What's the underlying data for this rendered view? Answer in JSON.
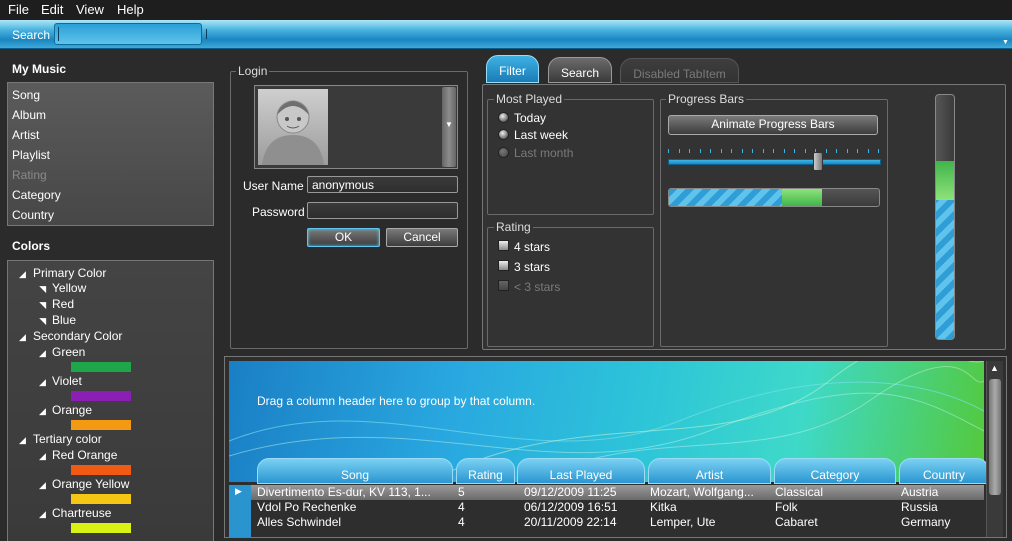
{
  "menu": {
    "items": [
      "File",
      "Edit",
      "View",
      "Help"
    ]
  },
  "searchbar": {
    "label": "Search",
    "value": ""
  },
  "my_music": {
    "title": "My Music",
    "items": [
      {
        "label": "Song",
        "disabled": false
      },
      {
        "label": "Album",
        "disabled": false
      },
      {
        "label": "Artist",
        "disabled": false
      },
      {
        "label": "Playlist",
        "disabled": false
      },
      {
        "label": "Rating",
        "disabled": true
      },
      {
        "label": "Category",
        "disabled": false
      },
      {
        "label": "Country",
        "disabled": false
      }
    ]
  },
  "colors": {
    "title": "Colors",
    "primary": {
      "label": "Primary Color",
      "children": [
        "Yellow",
        "Red",
        "Blue"
      ]
    },
    "secondary": {
      "label": "Secondary Color",
      "children": [
        {
          "label": "Green",
          "color": "#1fa64a"
        },
        {
          "label": "Violet",
          "color": "#8b1fb5"
        },
        {
          "label": "Orange",
          "color": "#f39a12"
        }
      ]
    },
    "tertiary": {
      "label": "Tertiary color",
      "children": [
        {
          "label": "Red Orange",
          "color": "#f05a12"
        },
        {
          "label": "Orange Yellow",
          "color": "#f5c613"
        },
        {
          "label": "Chartreuse",
          "color": "#d9f213"
        }
      ]
    }
  },
  "login": {
    "title": "Login",
    "username_label": "User Name",
    "username_value": "anonymous",
    "password_label": "Password",
    "password_value": "",
    "ok_label": "OK",
    "cancel_label": "Cancel"
  },
  "tabs": [
    {
      "label": "Filter",
      "state": "selected"
    },
    {
      "label": "Search",
      "state": "normal"
    },
    {
      "label": "Disabled TabItem",
      "state": "disabled"
    }
  ],
  "most_played": {
    "title": "Most Played",
    "options": [
      {
        "label": "Today",
        "disabled": false
      },
      {
        "label": "Last week",
        "disabled": false
      },
      {
        "label": "Last month",
        "disabled": true
      }
    ]
  },
  "rating": {
    "title": "Rating",
    "options": [
      {
        "label": "4 stars",
        "disabled": false
      },
      {
        "label": "3 stars",
        "disabled": false
      },
      {
        "label": "< 3 stars",
        "disabled": true
      }
    ]
  },
  "progress": {
    "title": "Progress Bars",
    "button_label": "Animate Progress Bars",
    "slider_value": 0.72,
    "horizontal_value": 0.73,
    "vertical_value": 0.73
  },
  "grid": {
    "group_hint": "Drag a column header here to group by that column.",
    "columns": [
      "Song",
      "Rating",
      "Last Played",
      "Artist",
      "Category",
      "Country"
    ],
    "rows": [
      [
        "Divertimento Es-dur, KV 113, 1...",
        "5",
        "09/12/2009 11:25",
        "Mozart, Wolfgang...",
        "Classical",
        "Austria"
      ],
      [
        "Vdol Po Rechenke",
        "4",
        "06/12/2009 16:51",
        "Kitka",
        "Folk",
        "Russia"
      ],
      [
        "Alles Schwindel",
        "4",
        "20/11/2009 22:14",
        "Lemper, Ute",
        "Cabaret",
        "Germany"
      ]
    ]
  }
}
